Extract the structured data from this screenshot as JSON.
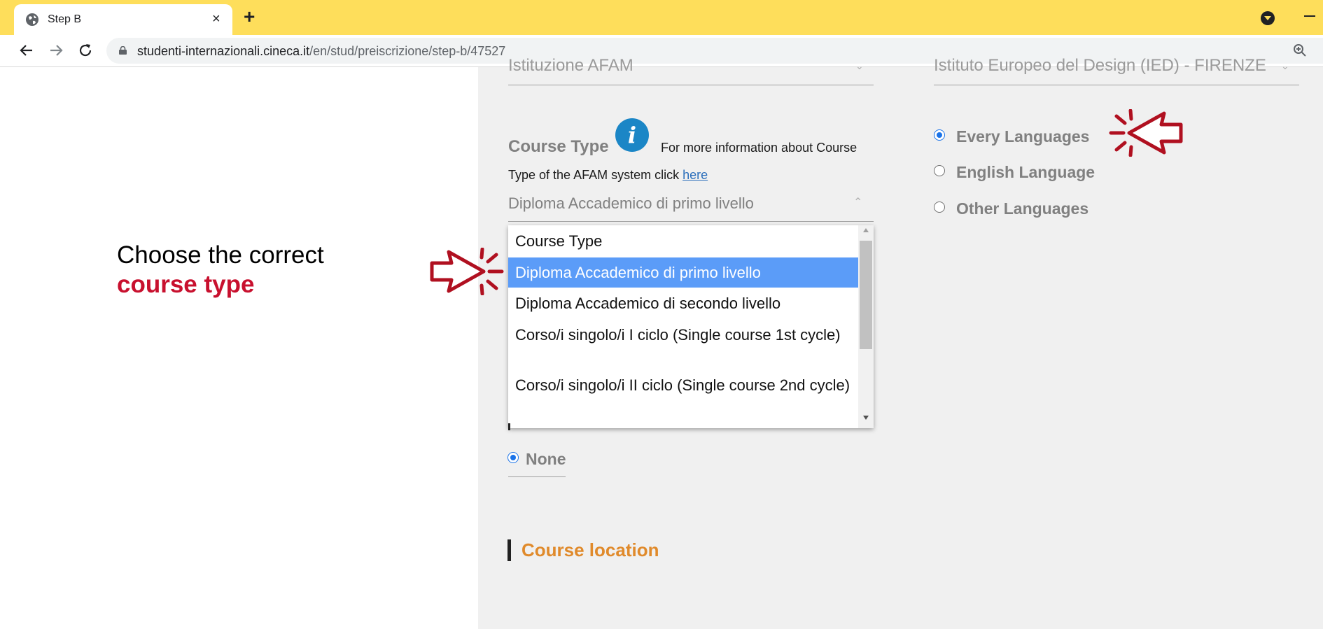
{
  "browser": {
    "tab_title": "Step B",
    "tab_close": "×",
    "new_tab": "+",
    "url_host": "studenti-internazionali.cineca.it",
    "url_path": "/en/stud/preiscrizione/step-b/47527"
  },
  "instruction": {
    "line1": "Choose the correct",
    "line2": "course type"
  },
  "form": {
    "cut_left": "Istituzione AFAM",
    "cut_right": "Istituto Europeo del Design (IED) - FIRENZE",
    "course_type_label": "Course Type",
    "info_icon_glyph": "i",
    "info_line1": "For more information about Course",
    "info_line2_prefix": "Type of the AFAM system click ",
    "info_link": "here",
    "selected_value": "Diploma Accademico di primo livello",
    "dropdown_options": [
      "Course Type",
      "Diploma Accademico di primo livello",
      "Diploma Accademico di secondo livello",
      "Corso/i singolo/i I ciclo (Single course 1st cycle)",
      "Corso/i singolo/i II ciclo (Single course 2nd cycle)"
    ],
    "selected_option_index": 1,
    "language_options": [
      {
        "label": "Every Languages",
        "checked": true
      },
      {
        "label": "English Language",
        "checked": false
      },
      {
        "label": "Other Languages",
        "checked": false
      }
    ],
    "none_label": "None",
    "course_location": "Course location"
  },
  "colors": {
    "tab_bar": "#fede5b",
    "highlight_red": "#c8102e",
    "arrow_red": "#b01020",
    "selected_option": "#5b9cf8",
    "section_title": "#e08a2b",
    "info_icon": "#1b86c6"
  },
  "icons": [
    "globe-icon",
    "close-icon",
    "plus-icon",
    "back-arrow-icon",
    "forward-arrow-icon",
    "reload-icon",
    "lock-icon",
    "zoom-icon",
    "info-icon",
    "pointer-arrow-icon"
  ]
}
